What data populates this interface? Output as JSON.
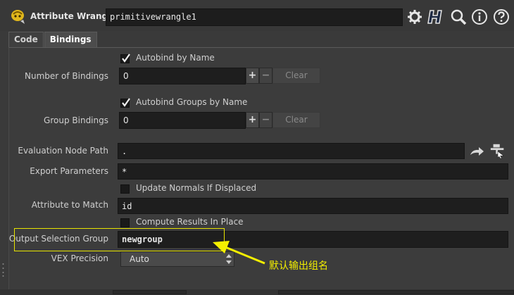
{
  "header": {
    "node_type": "Attribute Wrangle",
    "node_name": "primitivewrangle1"
  },
  "tabs": [
    {
      "label": "Code"
    },
    {
      "label": "Bindings"
    }
  ],
  "bindings": {
    "autobind_label": "Autobind by Name",
    "autobind_checked": true,
    "num_bindings_label": "Number of Bindings",
    "num_bindings_value": "0",
    "plus": "+",
    "minus": "−",
    "clear": "Clear",
    "autobind_groups_label": "Autobind Groups by Name",
    "autobind_groups_checked": true,
    "group_bindings_label": "Group Bindings",
    "group_bindings_value": "0",
    "eval_node_path_label": "Evaluation Node Path",
    "eval_node_path_value": ".",
    "export_params_label": "Export Parameters",
    "export_params_value": "*",
    "update_normals_label": "Update Normals If Displaced",
    "update_normals_checked": false,
    "attr_match_label": "Attribute to Match",
    "attr_match_value": "id",
    "compute_in_place_label": "Compute Results In Place",
    "compute_in_place_checked": false,
    "output_group_label": "Output Selection Group",
    "output_group_value": "newgroup",
    "vex_precision_label": "VEX Precision",
    "vex_precision_value": "Auto"
  },
  "annotation": {
    "text": "默认输出组名",
    "color": "#f4ef00"
  },
  "colors": {
    "background": "#3a3a3a",
    "field": "#1e1e1e",
    "highlight": "#e8e400"
  }
}
